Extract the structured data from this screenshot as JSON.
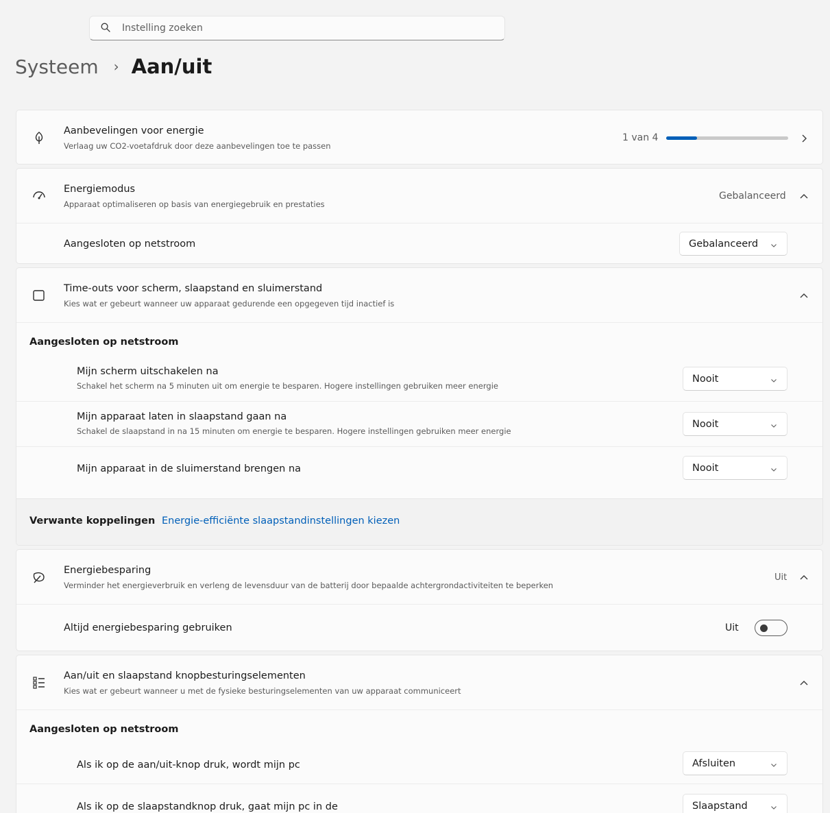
{
  "search": {
    "placeholder": "Instelling zoeken",
    "icon": "search-icon"
  },
  "breadcrumb": {
    "parent": "Systeem",
    "separator": "›",
    "current": "Aan/uit"
  },
  "accent_color": "#005fb8",
  "recommendations": {
    "title": "Aanbevelingen voor energie",
    "subtitle": "Verlaag uw CO2-voetafdruk door deze aanbevelingen toe te passen",
    "progress_text": "1 van 4",
    "progress_fraction": 0.25,
    "icon": "leaf-bulb-icon"
  },
  "power_mode": {
    "title": "Energiemodus",
    "subtitle": "Apparaat optimaliseren op basis van energiegebruik en prestaties",
    "value": "Gebalanceerd",
    "icon": "speedometer-icon",
    "row_label": "Aangesloten op netstroom",
    "dropdown_value": "Gebalanceerd"
  },
  "timeouts": {
    "title": "Time-outs voor scherm, slaapstand en sluimerstand",
    "subtitle": "Kies wat er gebeurt wanneer uw apparaat gedurende een opgegeven tijd inactief is",
    "icon": "screen-sleep-icon",
    "section_header": "Aangesloten op netstroom",
    "rows": [
      {
        "title": "Mijn scherm uitschakelen na",
        "subtitle": "Schakel het scherm na 5 minuten uit om energie te besparen. Hogere instellingen gebruiken meer energie",
        "value": "Nooit"
      },
      {
        "title": "Mijn apparaat laten in slaapstand gaan na",
        "subtitle": "Schakel de slaapstand in na 15 minuten om energie te besparen. Hogere instellingen gebruiken meer energie",
        "value": "Nooit"
      },
      {
        "title": "Mijn apparaat in de sluimerstand brengen na",
        "subtitle": "",
        "value": "Nooit"
      }
    ],
    "related_label": "Verwante koppelingen",
    "related_link": "Energie-efficiënte slaapstandinstellingen kiezen"
  },
  "energy_saver": {
    "title": "Energiebesparing",
    "subtitle": "Verminder het energieverbruik en verleng de levensduur van de batterij door bepaalde achtergrondactiviteiten te beperken",
    "value": "Uit",
    "icon": "leaf-saver-icon",
    "row_label": "Altijd energiebesparing gebruiken",
    "toggle_label": "Uit",
    "toggle_on": false
  },
  "buttons": {
    "title": "Aan/uit en slaapstand knopbesturingselementen",
    "subtitle": "Kies wat er gebeurt wanneer u met de fysieke besturingselementen van uw apparaat communiceert",
    "icon": "list-controls-icon",
    "section_header": "Aangesloten op netstroom",
    "rows": [
      {
        "title": "Als ik op de aan/uit-knop druk, wordt mijn pc",
        "value": "Afsluiten"
      },
      {
        "title": "Als ik op de slaapstandknop druk, gaat mijn pc in de",
        "value": "Slaapstand"
      }
    ]
  }
}
